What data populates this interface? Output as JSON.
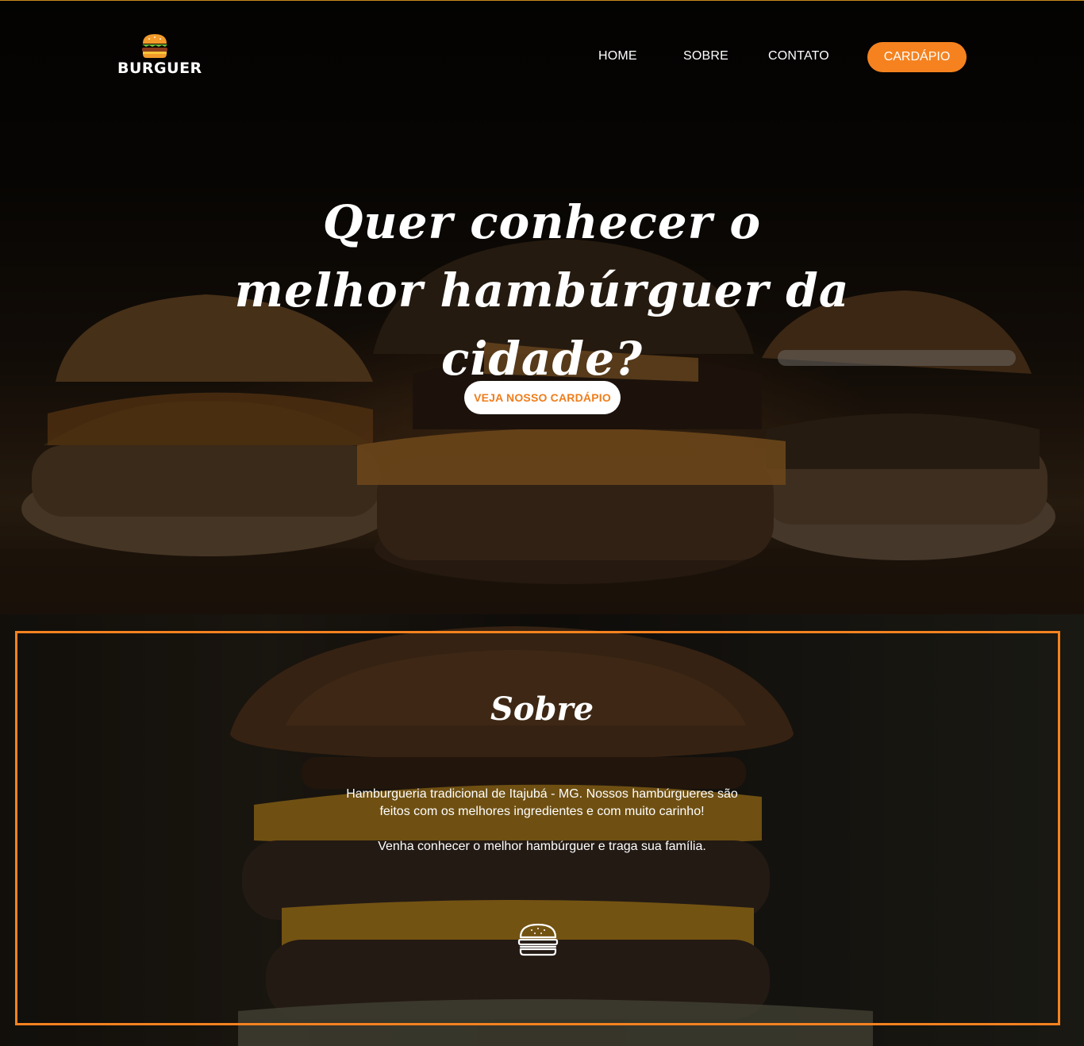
{
  "brand": {
    "logo_text": "BURGUER",
    "accent_color": "#f5821f",
    "logo_icon": "burger-icon"
  },
  "nav": {
    "home": "HOME",
    "sobre": "SOBRE",
    "contato": "CONTATO",
    "cta": "CARDÁPIO"
  },
  "hero": {
    "title": "Quer conhecer o melhor hambúrguer da cidade?",
    "button": "VEJA NOSSO CARDÁPIO"
  },
  "about": {
    "title": "Sobre",
    "paragraph_1": "Hamburgueria tradicional de Itajubá - MG. Nossos hambúrgueres são feitos com os melhores ingredientes e com muito carinho!",
    "paragraph_2": "Venha conhecer o melhor hambúrguer e traga sua família.",
    "icon": "burger-outline-icon"
  }
}
